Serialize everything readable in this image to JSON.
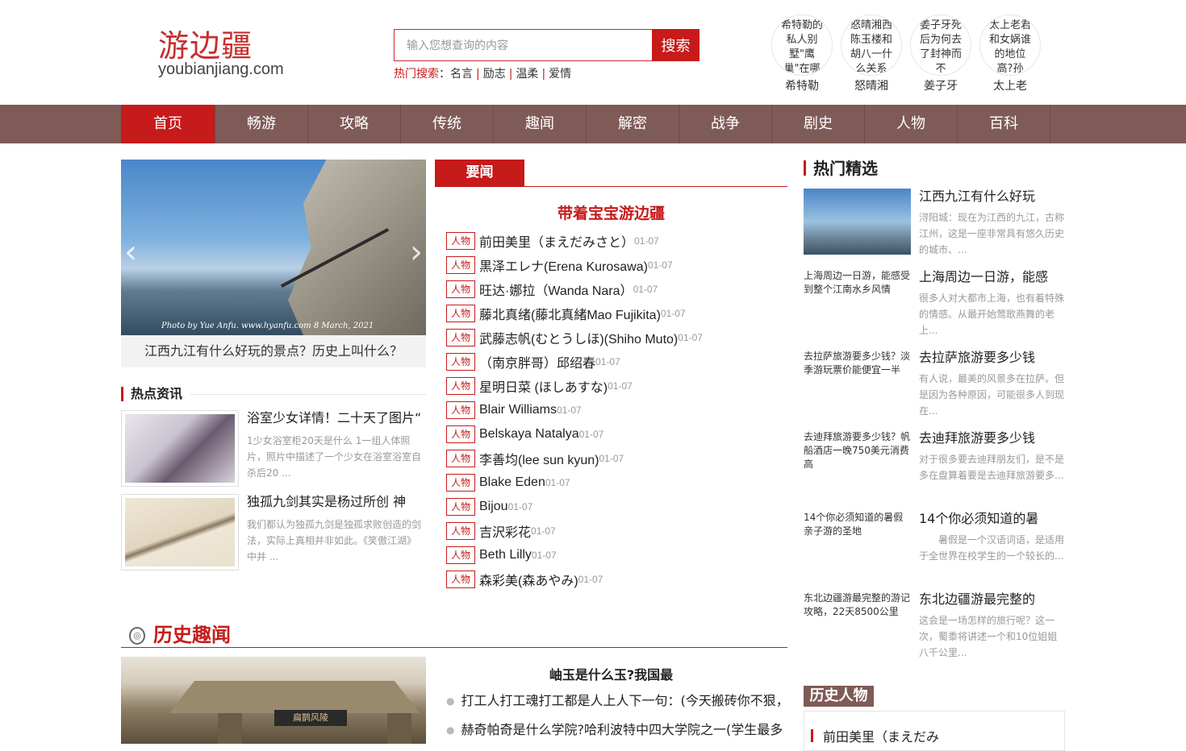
{
  "logo": {
    "cn": "游边疆",
    "en": "youbianjiang.com"
  },
  "search": {
    "placeholder": "输入您想查询的内容",
    "button": "搜索"
  },
  "hot_search": {
    "label": "热门搜索",
    "colon": "：",
    "items": [
      "名言",
      "励志",
      "温柔",
      "爱情"
    ]
  },
  "avatars": [
    {
      "alt": "希特勒的私人别墅\"鹰巢\"在哪",
      "name": "希特勒"
    },
    {
      "alt": "怒晴湘西陈玉楼和胡八一什么关系",
      "name": "怒晴湘"
    },
    {
      "alt": "姜子牙死后为何去了封神而不",
      "name": "姜子牙"
    },
    {
      "alt": "太上老君和女娲谁的地位高?孙",
      "name": "太上老"
    }
  ],
  "nav": [
    "首页",
    "畅游",
    "攻略",
    "传统",
    "趣闻",
    "解密",
    "战争",
    "剧史",
    "人物",
    "百科"
  ],
  "slider": {
    "title": "江西九江有什么好玩的景点？历史上叫什么？",
    "photo_caption": "Photo by Yue Anfu.    www.hyanfu.com    8 March, 2021",
    "prev": "‹",
    "next": "›"
  },
  "hot_news": {
    "title": "热点资讯",
    "items": [
      {
        "title": "浴室少女详情！二十天了图片“",
        "desc": "1少女浴室柜20天是什么 1一组人体照片，照片中描述了一个少女在浴室浴室自杀后20 ..."
      },
      {
        "title": "独孤九剑其实是杨过所创 神",
        "desc": "我们都认为独孤九剑是独孤求败创造的剑法，实际上真相并非如此。《笑傲江湖》中并 ..."
      }
    ]
  },
  "yaowen": {
    "tab": "要闻",
    "headline": "带着宝宝游边疆",
    "tag": "人物",
    "items": [
      {
        "text": "前田美里（まえだみさと）",
        "date": "01-07"
      },
      {
        "text": "黒泽エレナ(Erena Kurosawa)",
        "date": "01-07"
      },
      {
        "text": "旺达·娜拉（Wanda Nara）",
        "date": "01-07"
      },
      {
        "text": "藤北真绪(藤北真緒Mao Fujikita)",
        "date": "01-07"
      },
      {
        "text": "武藤志帆(むとうしほ)(Shiho Muto)",
        "date": "01-07"
      },
      {
        "text": "（南京胖哥）邱绍春",
        "date": "01-07"
      },
      {
        "text": "星明日菜 (ほしあすな)",
        "date": "01-07"
      },
      {
        "text": "Blair Williams",
        "date": "01-07"
      },
      {
        "text": "Belskaya Natalya",
        "date": "01-07"
      },
      {
        "text": "李善均(lee sun kyun)",
        "date": "01-07"
      },
      {
        "text": "Blake Eden",
        "date": "01-07"
      },
      {
        "text": "Bijou",
        "date": "01-07"
      },
      {
        "text": "吉沢彩花",
        "date": "01-07"
      },
      {
        "text": "Beth Lilly",
        "date": "01-07"
      },
      {
        "text": "森彩美(森あやみ)",
        "date": "01-07"
      }
    ]
  },
  "history_fun": {
    "title": "历史趣闻",
    "headline": "岫玉是什么玉?我国最",
    "plaque": "扁鹊风陵",
    "items": [
      "打工人打工魂打工都是人上人下一句：(今天搬砖你不狠，明",
      "赫奇帕奇是什么学院?哈利波特中四大学院之一(学生最多"
    ]
  },
  "right_main": {
    "title": "热门精选",
    "items": [
      {
        "thumb_alt": "",
        "title": "江西九江有什么好玩",
        "desc": "浔阳城：现在为江西的九江，古称江州，这是一座非常具有悠久历史的城市、..."
      },
      {
        "thumb_alt": "上海周边一日游，能感受到整个江南水乡风情",
        "title": "上海周边一日游，能感",
        "desc": "很多人对大都市上海，也有着特殊的情感。从最开始莺歌燕舞的老上..."
      },
      {
        "thumb_alt": "去拉萨旅游要多少钱？淡季游玩票价能便宜一半",
        "title": "去拉萨旅游要多少钱",
        "desc": "有人说，最美的风景多在拉萨。但是因为各种原因，可能很多人到现在..."
      },
      {
        "thumb_alt": "去迪拜旅游要多少钱？帆船酒店一晚750美元消费高",
        "title": "去迪拜旅游要多少钱",
        "desc": "对于很多要去迪拜朋友们，是不是多在盘算着要是去迪拜旅游要多..."
      },
      {
        "thumb_alt": "14个你必须知道的暑假亲子游的圣地",
        "title": "14个你必须知道的暑",
        "desc": "　　暑假是一个汉语词语，是适用于全世界在校学生的一个较长的..."
      },
      {
        "thumb_alt": "东北边疆游最完整的游记攻略，22天8500公里",
        "title": "东北边疆游最完整的",
        "desc": "这会是一场怎样的旅行呢？这一次，蜀黍将讲述一个和10位姐姐八千公里..."
      }
    ]
  },
  "history_people": {
    "title": "历史人物",
    "first": "前田美里（まえだみ"
  },
  "colors": {
    "accent": "#c71a1a",
    "nav_bg": "#7f5b58"
  }
}
